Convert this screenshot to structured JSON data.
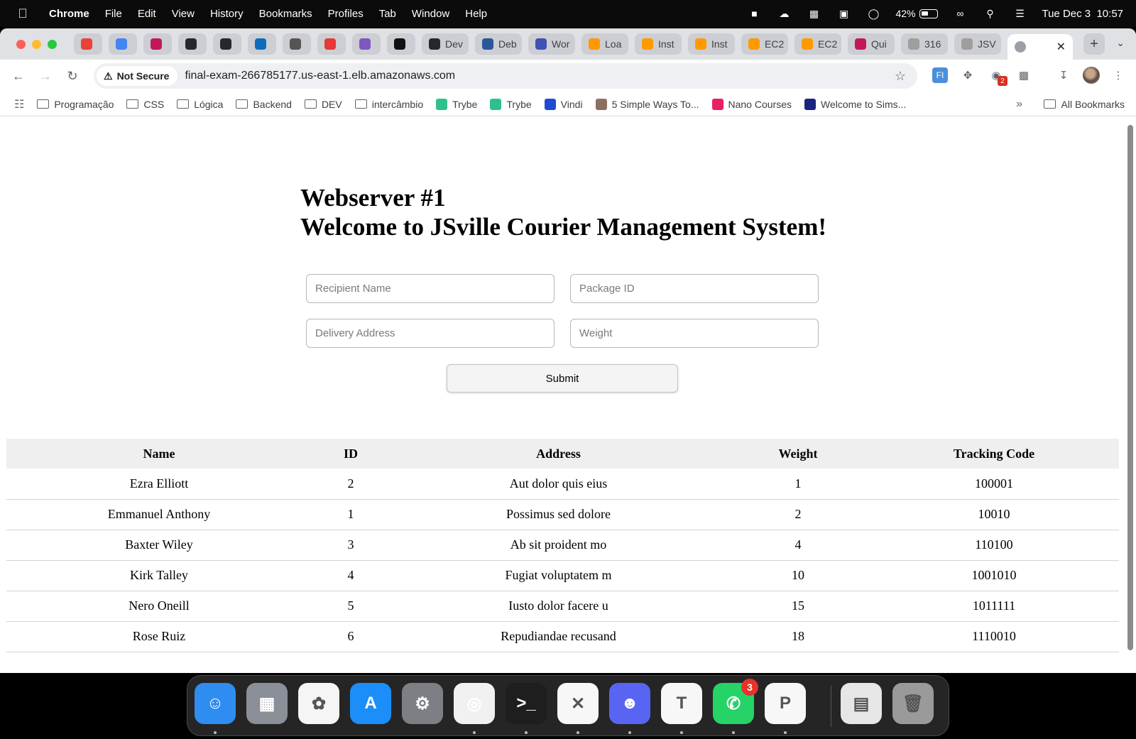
{
  "menubar": {
    "app": "Chrome",
    "items": [
      "File",
      "Edit",
      "View",
      "History",
      "Bookmarks",
      "Profiles",
      "Tab",
      "Window",
      "Help"
    ],
    "battery_percent": "42%",
    "datetime": "Tue Dec 3  10:57"
  },
  "tabs": [
    {
      "label": "",
      "favicon_color": "#ea4335"
    },
    {
      "label": "",
      "favicon_color": "#4285f4"
    },
    {
      "label": "",
      "favicon_color": "#c2185b"
    },
    {
      "label": "",
      "favicon_color": "#24292f"
    },
    {
      "label": "",
      "favicon_color": "#24292f"
    },
    {
      "label": "",
      "favicon_color": "#0f6cbd"
    },
    {
      "label": "",
      "favicon_color": "#555555"
    },
    {
      "label": "",
      "favicon_color": "#e53935"
    },
    {
      "label": "",
      "favicon_color": "#7e57c2"
    },
    {
      "label": "",
      "favicon_color": "#111111"
    },
    {
      "label": "Dev",
      "favicon_color": "#24292f"
    },
    {
      "label": "Deb",
      "favicon_color": "#2b579a"
    },
    {
      "label": "Wor",
      "favicon_color": "#3f51b5"
    },
    {
      "label": "Loa",
      "favicon_color": "#ff9900"
    },
    {
      "label": "Inst",
      "favicon_color": "#ff9900"
    },
    {
      "label": "Inst",
      "favicon_color": "#ff9900"
    },
    {
      "label": "EC2",
      "favicon_color": "#ff9900"
    },
    {
      "label": "EC2",
      "favicon_color": "#ff9900"
    },
    {
      "label": "Qui",
      "favicon_color": "#c2185b"
    },
    {
      "label": "316",
      "favicon_color": "#9e9e9e"
    },
    {
      "label": "JSV",
      "favicon_color": "#9e9e9e"
    }
  ],
  "toolbar": {
    "security_label": "Not Secure",
    "url": "final-exam-266785177.us-east-1.elb.amazonaws.com",
    "extension_badge": "2"
  },
  "bookmarks": [
    {
      "label": "Programação",
      "type": "folder"
    },
    {
      "label": "CSS",
      "type": "folder"
    },
    {
      "label": "Lógica",
      "type": "folder"
    },
    {
      "label": "Backend",
      "type": "folder"
    },
    {
      "label": "DEV",
      "type": "folder"
    },
    {
      "label": "intercâmbio",
      "type": "folder"
    },
    {
      "label": "Trybe",
      "type": "link",
      "color": "#2fc18c"
    },
    {
      "label": "Trybe",
      "type": "link",
      "color": "#2fc18c"
    },
    {
      "label": "Vindi",
      "type": "link",
      "color": "#1e4bd2"
    },
    {
      "label": "5 Simple Ways To...",
      "type": "link",
      "color": "#8d6e63"
    },
    {
      "label": "Nano Courses",
      "type": "link",
      "color": "#e91e63"
    },
    {
      "label": "Welcome to Sims...",
      "type": "link",
      "color": "#1a237e"
    }
  ],
  "all_bookmarks_label": "All Bookmarks",
  "page": {
    "title_line1": "Webserver #1",
    "title_line2": "Welcome to JSville Courier Management System!",
    "form": {
      "recipient_placeholder": "Recipient Name",
      "package_placeholder": "Package ID",
      "address_placeholder": "Delivery Address",
      "weight_placeholder": "Weight",
      "submit_label": "Submit"
    },
    "table": {
      "headers": [
        "Name",
        "ID",
        "Address",
        "Weight",
        "Tracking Code"
      ],
      "rows": [
        [
          "Ezra Elliott",
          "2",
          "Aut dolor quis eius",
          "1",
          "100001"
        ],
        [
          "Emmanuel Anthony",
          "1",
          "Possimus sed dolore",
          "2",
          "10010"
        ],
        [
          "Baxter Wiley",
          "3",
          "Ab sit proident mo",
          "4",
          "110100"
        ],
        [
          "Kirk Talley",
          "4",
          "Fugiat voluptatem m",
          "10",
          "1001010"
        ],
        [
          "Nero Oneill",
          "5",
          "Iusto dolor facere u",
          "15",
          "1011111"
        ],
        [
          "Rose Ruiz",
          "6",
          "Repudiandae recusand",
          "18",
          "1110010"
        ]
      ]
    }
  },
  "dock": {
    "items": [
      {
        "name": "finder-icon",
        "color": "#2f8cf0"
      },
      {
        "name": "launchpad-icon",
        "color": "#8a8f98"
      },
      {
        "name": "photos-icon",
        "color": "#f5f5f5"
      },
      {
        "name": "app-store-icon",
        "color": "#1c8ef9"
      },
      {
        "name": "system-settings-icon",
        "color": "#7d7f84"
      },
      {
        "name": "chrome-icon",
        "color": "#f1f1f1"
      },
      {
        "name": "terminal-icon",
        "color": "#1e1e1e"
      },
      {
        "name": "vscode-icon",
        "color": "#f7f7f7"
      },
      {
        "name": "discord-icon",
        "color": "#5865f2"
      },
      {
        "name": "teams-icon",
        "color": "#f7f7f7"
      },
      {
        "name": "whatsapp-icon",
        "color": "#25d366"
      },
      {
        "name": "powerpoint-icon",
        "color": "#f7f7f7"
      },
      {
        "name": "pdf-document-icon",
        "color": "#e6e6e6"
      },
      {
        "name": "trash-icon",
        "color": "#9a9a9a"
      }
    ],
    "whatsapp_badge": "3"
  }
}
